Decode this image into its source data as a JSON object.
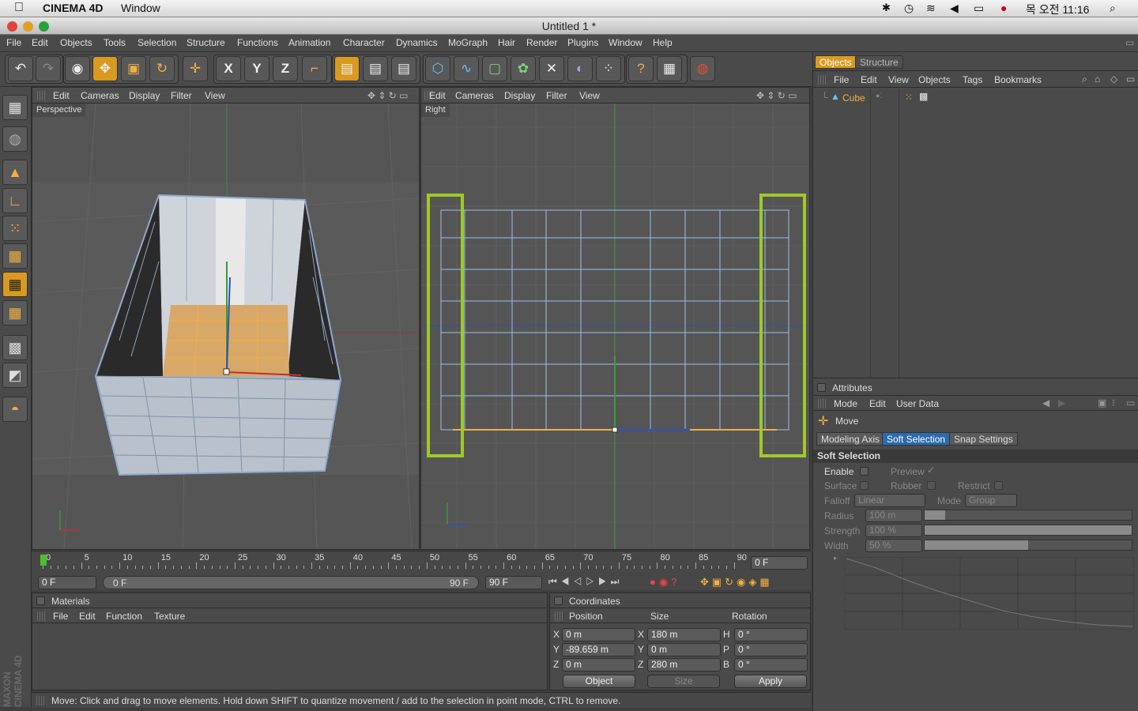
{
  "mac_menubar": {
    "app": "CINEMA 4D",
    "menu": "Window",
    "clock": "목 오전 11:16"
  },
  "window": {
    "title": "Untitled 1 *"
  },
  "menu": [
    "File",
    "Edit",
    "Objects",
    "Tools",
    "Selection",
    "Structure",
    "Functions",
    "Animation",
    "Character",
    "Dynamics",
    "MoGraph",
    "Hair",
    "Render",
    "Plugins",
    "Window",
    "Help"
  ],
  "viewport_menu": [
    "Edit",
    "Cameras",
    "Display",
    "Filter",
    "View"
  ],
  "viewports": {
    "left": "Perspective",
    "right": "Right"
  },
  "axis_tools": {
    "x": "X",
    "y": "Y",
    "z": "Z"
  },
  "timeline": {
    "ticks": [
      "0",
      "5",
      "10",
      "15",
      "20",
      "25",
      "30",
      "35",
      "40",
      "45",
      "50",
      "55",
      "60",
      "65",
      "70",
      "75",
      "80",
      "85",
      "90"
    ],
    "current_frame": "0 F",
    "start": "0 F",
    "range_start": "0 F",
    "range_end": "90 F",
    "end": "90 F"
  },
  "materials": {
    "title": "Materials",
    "menu": [
      "File",
      "Edit",
      "Function",
      "Texture"
    ]
  },
  "coordinates": {
    "title": "Coordinates",
    "headers": {
      "position": "Position",
      "size": "Size",
      "rotation": "Rotation"
    },
    "rows": [
      {
        "axis": "X",
        "pos": "0 m",
        "saxis": "X",
        "size": "180 m",
        "raxis": "H",
        "rot": "0 °"
      },
      {
        "axis": "Y",
        "pos": "-89.659 m",
        "saxis": "Y",
        "size": "0 m",
        "raxis": "P",
        "rot": "0 °"
      },
      {
        "axis": "Z",
        "pos": "0 m",
        "saxis": "Z",
        "size": "280 m",
        "raxis": "B",
        "rot": "0 °"
      }
    ],
    "mode": "Object",
    "size_mode": "Size",
    "apply": "Apply"
  },
  "status": "Move: Click and drag to move elements. Hold down SHIFT to quantize movement / add to the selection in point mode, CTRL to remove.",
  "brand": "MAXON CINEMA 4D",
  "objects_panel": {
    "tabs": [
      "Objects",
      "Structure"
    ],
    "menu": [
      "File",
      "Edit",
      "View",
      "Objects",
      "Tags",
      "Bookmarks"
    ],
    "items": [
      {
        "name": "Cube"
      }
    ]
  },
  "attributes": {
    "title": "Attributes",
    "menu": [
      "Mode",
      "Edit",
      "User Data"
    ],
    "tool": "Move",
    "tabs": [
      "Modeling Axis",
      "Soft Selection",
      "Snap Settings"
    ],
    "section": "Soft Selection",
    "enable": "Enable",
    "preview": "Preview",
    "surface": "Surface",
    "rubber": "Rubber",
    "restrict": "Restrict",
    "falloff_label": "Falloff",
    "falloff": "Linear",
    "mode_label": "Mode",
    "mode": "Group",
    "radius_label": "Radius",
    "radius": "100 m",
    "radius_level": 0.1,
    "strength_label": "Strength",
    "strength": "100 %",
    "strength_level": 1.0,
    "width_label": "Width",
    "width": "50 %",
    "width_level": 0.5
  },
  "colors": {
    "accent": "#2a6bb0",
    "highlight": "#d99a1f",
    "boundary": "#9ccb28"
  }
}
